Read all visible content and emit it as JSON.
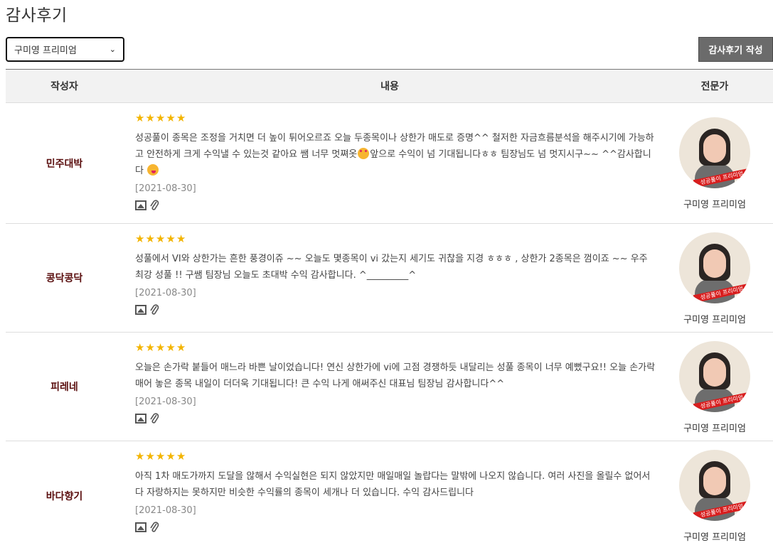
{
  "page": {
    "title": "감사후기"
  },
  "filter": {
    "selected": "구미영 프리미엄"
  },
  "actions": {
    "write_label": "감사후기 작성"
  },
  "table": {
    "headers": {
      "author": "작성자",
      "content": "내용",
      "expert": "전문가"
    },
    "rows": [
      {
        "author": "민주대박",
        "rating": 5,
        "text_parts": [
          "성공풀이 종목은 조정을 거치면 더 높이 튀어오르죠 오늘 두종목이나 상한가 매도로 증명^^ 철저한 자금흐름분석을 해주시기에 가능하고 안전하게 크게 수익낼 수 있는것 같아요 쌤 너무 멋쪄옷",
          "앞으로 수익이 넘 기대됩니다ㅎㅎ 팀장님도 넘 멋지시구~~ ^^감사합니다 "
        ],
        "date": "[2021-08-30]",
        "expert_name": "구미영 프리미엄",
        "avatar_banner": "성공풀이 프리미엄"
      },
      {
        "author": "콩닥콩닥",
        "rating": 5,
        "text": "성풀에서 VI와 상한가는 흔한 풍경이쥬 ~~ 오늘도 몇종목이 vi 갔는지 세기도 귀찮을 지경 ㅎㅎㅎ , 상한가 2종목은 껌이죠 ~~ 우주최강 성풀 !! 구쌤 팀장님 오늘도 초대박 수익 감사합니다. ^_________^",
        "date": "[2021-08-30]",
        "expert_name": "구미영 프리미엄",
        "avatar_banner": "성공풀이 프리미엄"
      },
      {
        "author": "피레네",
        "rating": 5,
        "text": "오늘은 손가락 붙들어 매느라 바쁜 날이었습니다! 연신 상한가에 vi에 고점 경쟁하듯 내달리는 성풀 종목이 너무 예뻤구요!! 오늘 손가락 매어 놓은 종목 내일이 더더욱 기대됩니다! 큰 수익 나게 애써주신 대표님 팀장님 감사합니다^^",
        "date": "[2021-08-30]",
        "expert_name": "구미영 프리미엄",
        "avatar_banner": "성공풀이 프리미엄"
      },
      {
        "author": "바다향기",
        "rating": 5,
        "text": "아직 1차 매도가까지 도달을 않해서 수익실현은 되지 않았지만 매일매일 놀랍다는 말밖에 나오지 않습니다. 여러 사진을 올릴수 없어서 다 자랑하지는 못하지만 비슷한 수익률의 종목이 세개나 더 있습니다. 수익 감사드립니다",
        "date": "[2021-08-30]",
        "expert_name": "구미영 프리미엄",
        "avatar_banner": "성공풀이 프리미엄"
      }
    ]
  },
  "icons": {
    "star": "star-icon",
    "image": "image-icon",
    "attachment": "paperclip-icon",
    "dropdown": "chevron-down-icon"
  },
  "colors": {
    "star": "#f3b400",
    "author": "#5a0e0e",
    "button_bg": "#6b6b6b"
  }
}
